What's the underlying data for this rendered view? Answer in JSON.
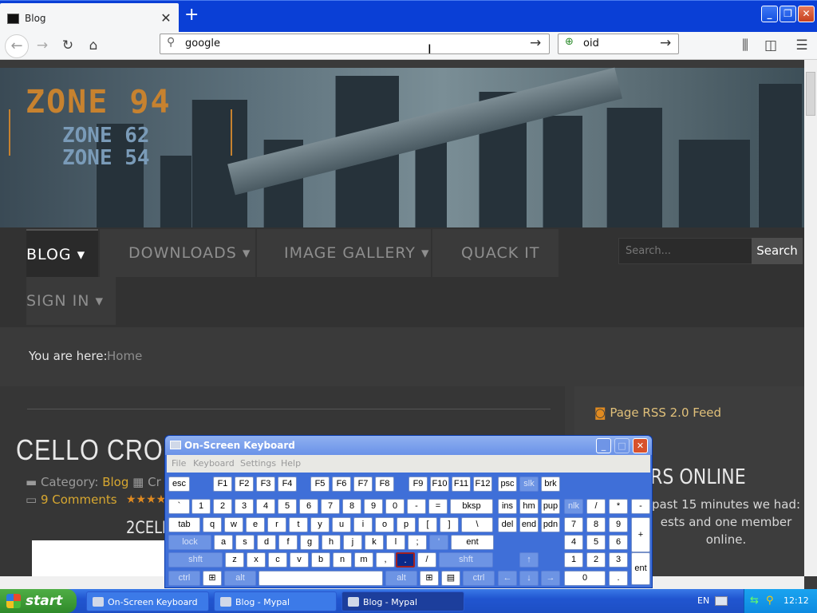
{
  "browser": {
    "tab_title": "Blog",
    "tab_close": "✕",
    "new_tab": "+",
    "url_value": "google",
    "search_value": "oid",
    "window_buttons": {
      "minimize": "_",
      "restore": "❐",
      "close": "✕"
    }
  },
  "site": {
    "logo_main": "ZONE 94",
    "logo_sub1": "ZONE 62",
    "logo_sub2": "ZONE 54",
    "menu": [
      {
        "label": "BLOG ▾"
      },
      {
        "label": "DOWNLOADS ▾"
      },
      {
        "label": "IMAGE GALLERY ▾"
      },
      {
        "label": "QUACK IT"
      },
      {
        "label": "SIGN IN ▾"
      }
    ],
    "search_placeholder": "Search...",
    "search_button": "Search",
    "breadcrumb_label": "You are here:",
    "breadcrumb_home": "Home",
    "article_title": "CELLO CROSSO",
    "article_meta_prefix": "Category:",
    "article_category": "Blog",
    "article_meta_extra": "Cr",
    "article_comments": "9 Comments",
    "article_stars": "★★★★",
    "article_subtitle": "2CELL",
    "rss_label": "Page RSS 2.0 Feed",
    "online_header": "RS ONLINE",
    "online_text": "past 15 minutes we had: ests and one member online."
  },
  "osk": {
    "title": "On-Screen Keyboard",
    "menu": [
      "File",
      "Keyboard",
      "Settings",
      "Help"
    ],
    "row1": [
      "esc",
      "F1",
      "F2",
      "F3",
      "F4",
      "F5",
      "F6",
      "F7",
      "F8",
      "F9",
      "F10",
      "F11",
      "F12",
      "psc",
      "slk",
      "brk"
    ],
    "row2": [
      "`",
      "1",
      "2",
      "3",
      "4",
      "5",
      "6",
      "7",
      "8",
      "9",
      "0",
      "-",
      "=",
      "bksp",
      "ins",
      "hm",
      "pup",
      "nlk",
      "/",
      "*",
      "-"
    ],
    "row3": [
      "tab",
      "q",
      "w",
      "e",
      "r",
      "t",
      "y",
      "u",
      "i",
      "o",
      "p",
      "[",
      "]",
      "\\",
      "del",
      "end",
      "pdn",
      "7",
      "8",
      "9",
      "+"
    ],
    "row4": [
      "lock",
      "a",
      "s",
      "d",
      "f",
      "g",
      "h",
      "j",
      "k",
      "l",
      ";",
      "'",
      "ent",
      "4",
      "5",
      "6"
    ],
    "row5": [
      "shft",
      "z",
      "x",
      "c",
      "v",
      "b",
      "n",
      "m",
      ",",
      ".",
      "/",
      "shft",
      "↑",
      "1",
      "2",
      "3",
      "ent"
    ],
    "row6": [
      "ctrl",
      "⊞",
      "alt",
      "",
      "alt",
      "⊞",
      "▤",
      "ctrl",
      "←",
      "↓",
      "→",
      "0",
      "."
    ]
  },
  "taskbar": {
    "start": "start",
    "items": [
      "On-Screen Keyboard",
      "Blog - Mypal",
      "Blog - Mypal"
    ],
    "lang": "EN",
    "clock": "12:12"
  }
}
